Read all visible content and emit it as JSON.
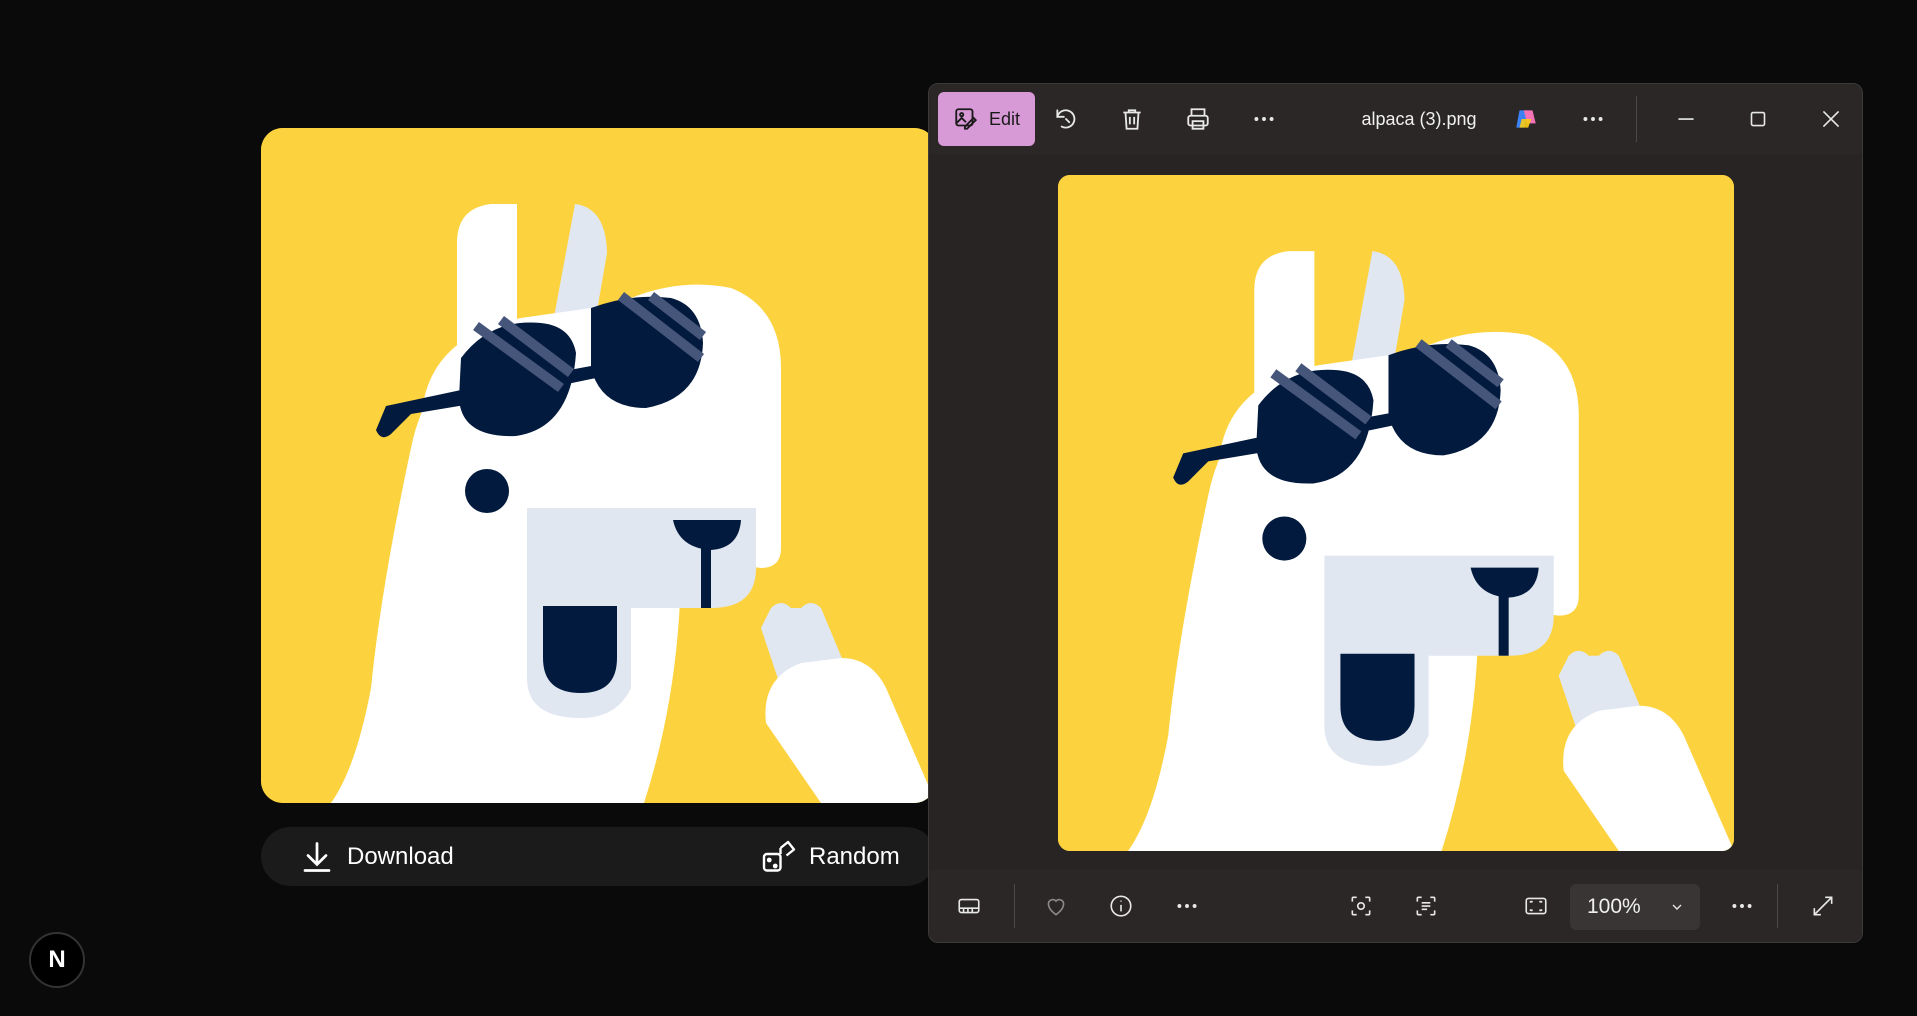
{
  "app": {
    "download_label": "Download",
    "random_label": "Random",
    "badge_letter": "N"
  },
  "viewer": {
    "edit_label": "Edit",
    "filename": "alpaca (3).png",
    "zoom_level": "100%"
  },
  "colors": {
    "background": "#fcd33f",
    "alpaca": "#ffffff",
    "shade": "#e1e7f1",
    "dark": "#021a3d",
    "edit_accent": "#d89ad6"
  }
}
